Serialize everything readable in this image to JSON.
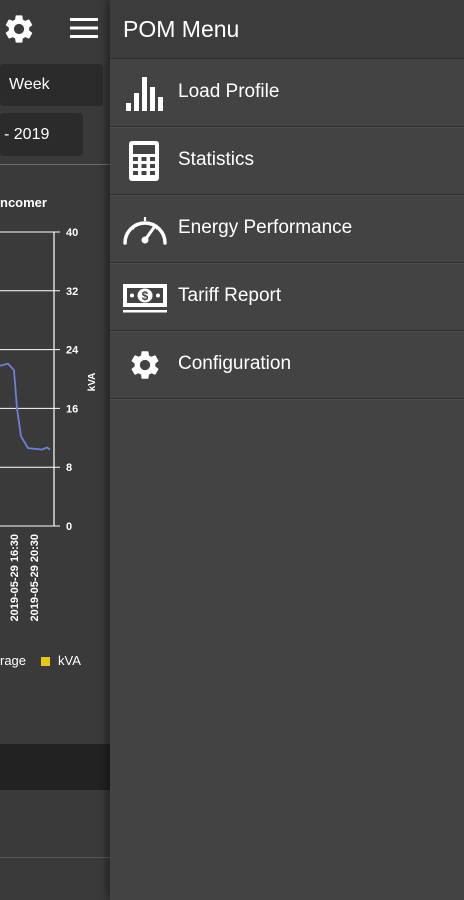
{
  "background_app": {
    "period_selector": "Week",
    "date_range_fragment": "- 2019",
    "chart_title_fragment": "ncomer",
    "legend": [
      {
        "label": "rage",
        "color": ""
      },
      {
        "label": "kVA",
        "color": "#e6c619"
      }
    ]
  },
  "chart_data": {
    "type": "line",
    "title": "ncomer",
    "ylabel": "kVA",
    "ylim": [
      0,
      40
    ],
    "y_ticks": [
      "0",
      "8",
      "16",
      "24",
      "32",
      "40"
    ],
    "x_tick_labels": [
      "2019-05-29 16:30",
      "2019-05-29 20:30"
    ],
    "series": [
      {
        "name": "rage",
        "color": "#6f7fd6",
        "values": [
          21.8,
          22.1,
          21.2,
          16.0,
          12.2,
          10.6,
          10.5,
          10.4,
          10.7,
          10.4
        ]
      }
    ]
  },
  "drawer": {
    "title": "POM Menu",
    "items": [
      {
        "label": "Load Profile",
        "icon": "bar-chart-icon"
      },
      {
        "label": "Statistics",
        "icon": "calculator-icon"
      },
      {
        "label": "Energy Performance",
        "icon": "speedometer-icon"
      },
      {
        "label": "Tariff Report",
        "icon": "money-icon"
      },
      {
        "label": "Configuration",
        "icon": "gear-icon"
      }
    ]
  },
  "colors": {
    "drawer_bg": "#434343",
    "header_bg": "#3c3c3c",
    "series_line": "#6f7fd6",
    "legend_kva": "#e6c619"
  }
}
